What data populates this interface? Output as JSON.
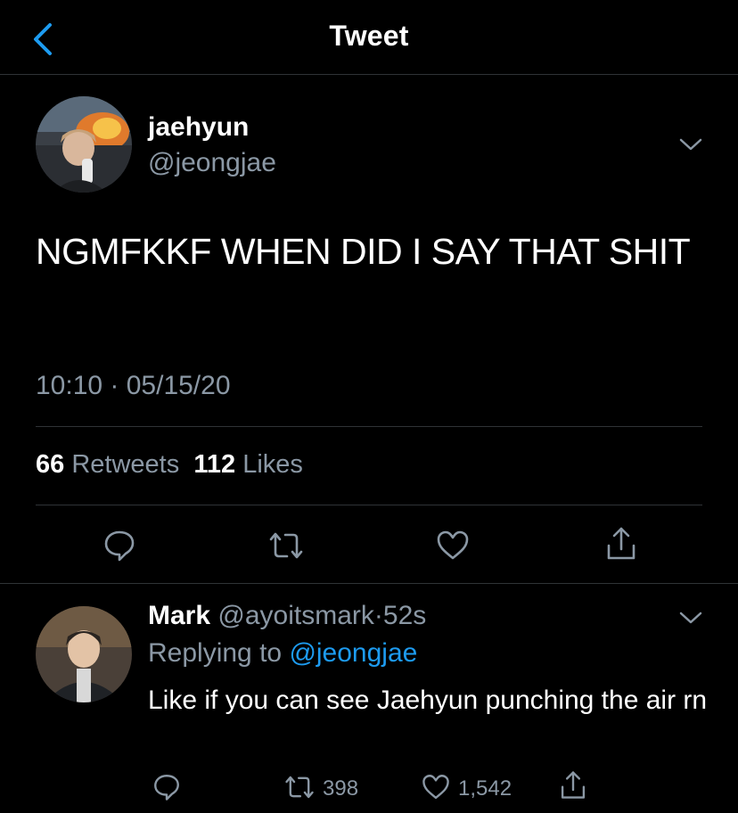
{
  "header": {
    "title": "Tweet"
  },
  "tweet": {
    "name": "jaehyun",
    "handle": "@jeongjae",
    "text": "NGMFKKF WHEN DID I SAY THAT SHIT",
    "timestamp": "10:10 · 05/15/20",
    "retweets_count": "66",
    "retweets_label": "Retweets",
    "likes_count": "112",
    "likes_label": "Likes"
  },
  "reply": {
    "name": "Mark",
    "handle": "@ayoitsmark",
    "time": "52s",
    "replying_label": "Replying to",
    "replying_handle": "@jeongjae",
    "text": "Like if you can see Jaehyun punching the air rn",
    "retweets": "398",
    "likes": "1,542"
  },
  "colors": {
    "background": "#000000",
    "muted": "#8b98a5",
    "accent": "#1d9bf0",
    "divider": "#2f3336"
  }
}
